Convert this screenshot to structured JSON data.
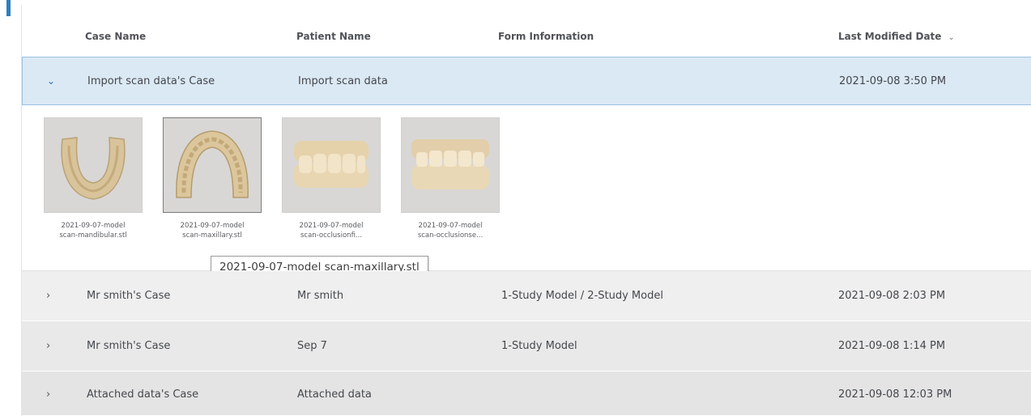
{
  "table": {
    "columns": {
      "case_name": "Case Name",
      "patient_name": "Patient Name",
      "form_information": "Form Information",
      "last_modified_date": "Last Modified Date",
      "sort_icon": "chevron-down-icon"
    },
    "expanded_row": {
      "case_name": "Import scan data's Case",
      "patient_name": "Import scan data",
      "form_information": "",
      "last_modified_date": "2021-09-08 3:50 PM",
      "files": [
        {
          "line1": "2021-09-07-model",
          "line2": "scan-mandibular.stl",
          "icon": "mandibular-scan-thumbnail"
        },
        {
          "line1": "2021-09-07-model",
          "line2": "scan-maxillary.stl",
          "icon": "maxillary-scan-thumbnail",
          "selected": true
        },
        {
          "line1": "2021-09-07-model",
          "line2": "scan-occlusionfi...",
          "icon": "occlusion-scan-thumbnail"
        },
        {
          "line1": "2021-09-07-model",
          "line2": "scan-occlusionse...",
          "icon": "occlusion-scan-thumbnail"
        }
      ],
      "tooltip": "2021-09-07-model scan-maxillary.stl"
    },
    "rows": [
      {
        "case_name": "Mr smith's Case",
        "patient_name": "Mr smith",
        "form_information": "1-Study Model / 2-Study Model",
        "last_modified_date": "2021-09-08 2:03 PM"
      },
      {
        "case_name": "Mr smith's Case",
        "patient_name": "Sep 7",
        "form_information": "1-Study Model",
        "last_modified_date": "2021-09-08 1:14 PM"
      },
      {
        "case_name": "Attached data's Case",
        "patient_name": "Attached data",
        "form_information": "",
        "last_modified_date": "2021-09-08 12:03 PM"
      }
    ]
  },
  "colors": {
    "accent": "#2e7fc1",
    "expanded_row_bg": "#dbe9f5",
    "row_bg": "#ececec",
    "model_tan": "#e3cfa8"
  }
}
